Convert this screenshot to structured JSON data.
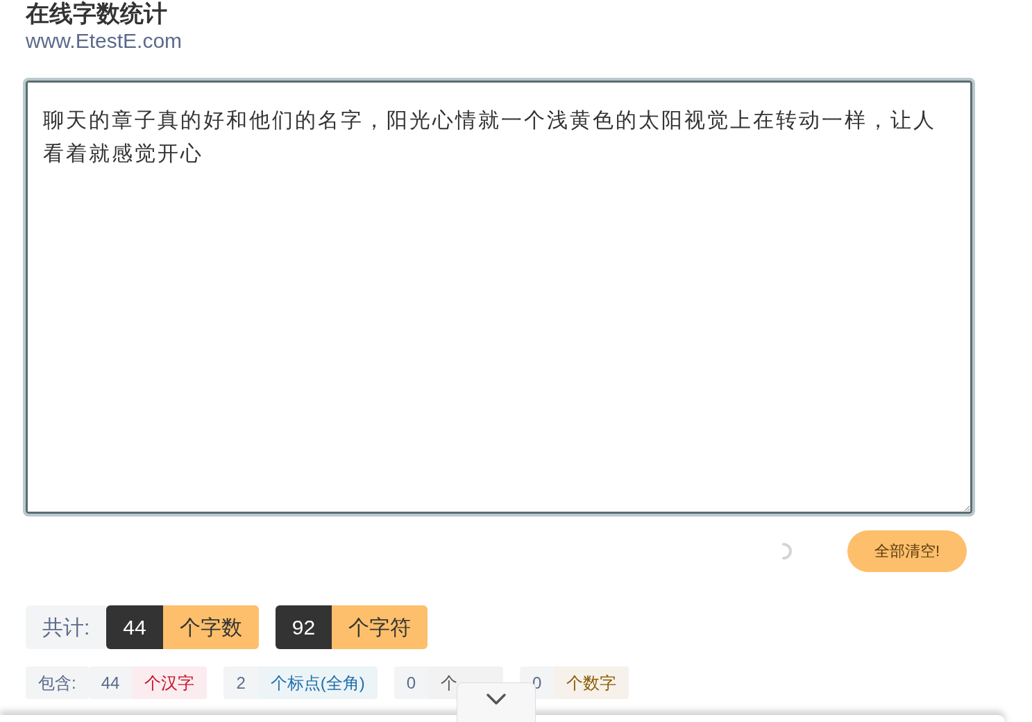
{
  "header": {
    "title": "在线字数统计",
    "site": "www.EtestE.com"
  },
  "editor": {
    "value": "聊天的章子真的好和他们的名字，阳光心情就一个浅黄色的太阳视觉上在转动一样，让人看着就感觉开心"
  },
  "clear_button": "全部清空!",
  "totals": {
    "label": "共计:",
    "items": [
      {
        "count": "44",
        "unit": "个字数"
      },
      {
        "count": "92",
        "unit": "个字符"
      }
    ]
  },
  "breakdown": {
    "label": "包含:",
    "items": [
      {
        "count": "44",
        "unit": "个汉字",
        "color": "#c8102e"
      },
      {
        "count": "2",
        "unit": "个标点(全角)",
        "color": "#1f6fa8"
      },
      {
        "count": "0",
        "unit": "个",
        "color": "#555555"
      },
      {
        "count": "0",
        "unit": "个数字",
        "color": "#8a5a00"
      }
    ]
  }
}
